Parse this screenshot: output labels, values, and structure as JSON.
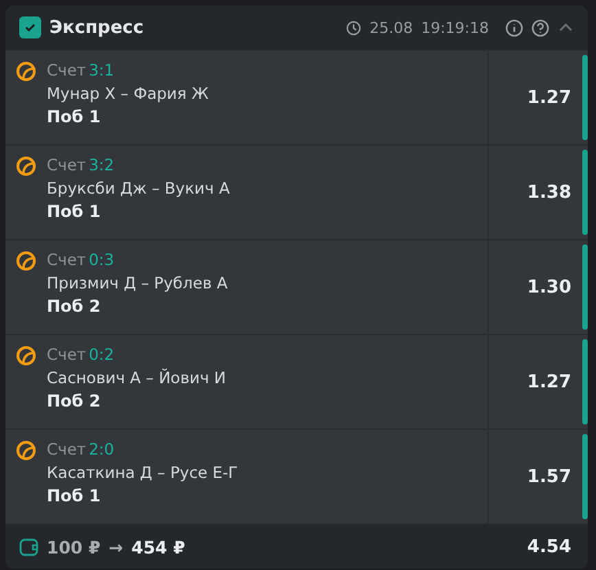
{
  "header": {
    "checked": true,
    "title": "Экспресс",
    "date": "25.08",
    "time": "19:19:18",
    "expanded": true
  },
  "bets": [
    {
      "score_label": "Счет",
      "score": "3:1",
      "match": "Мунар Х – Фария Ж",
      "outcome": "Поб 1",
      "odds": "1.27"
    },
    {
      "score_label": "Счет",
      "score": "3:2",
      "match": "Бруксби Дж – Вукич А",
      "outcome": "Поб 1",
      "odds": "1.38"
    },
    {
      "score_label": "Счет",
      "score": "0:3",
      "match": "Призмич Д – Рублев А",
      "outcome": "Поб 2",
      "odds": "1.30"
    },
    {
      "score_label": "Счет",
      "score": "0:2",
      "match": "Саснович А – Йович И",
      "outcome": "Поб 2",
      "odds": "1.27"
    },
    {
      "score_label": "Счет",
      "score": "2:0",
      "match": "Касаткина Д – Русе Е-Г",
      "outcome": "Поб 1",
      "odds": "1.57"
    }
  ],
  "footer": {
    "stake": "100 ₽",
    "arrow": "→",
    "payout": "454 ₽",
    "total_odds": "4.54"
  }
}
